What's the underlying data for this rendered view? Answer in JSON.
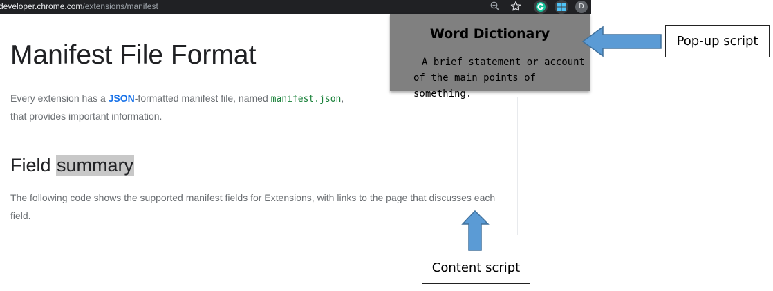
{
  "browser": {
    "url_host": "developer.chrome.com",
    "url_path": "/extensions/manifest",
    "avatar_letter": "D",
    "icons": [
      "zoom-icon",
      "star-icon",
      "grammarly-icon",
      "windows-icon"
    ]
  },
  "page": {
    "title": "Manifest File Format",
    "intro": {
      "prefix": "Every extension has a ",
      "json_link": "JSON",
      "middle": "-formatted manifest file, named ",
      "code": "manifest.json",
      "suffix_line1": ",",
      "line2": "that provides important information."
    },
    "section": {
      "title_plain": "Field ",
      "title_highlight": "summary"
    },
    "body": "The following code shows the supported manifest fields for Extensions, with links to the page that discusses each field."
  },
  "popup": {
    "title": "Word Dictionary",
    "definition": "A brief statement or account of the main points of something."
  },
  "annotations": {
    "popup_label": "Pop-up script",
    "content_label": "Content script",
    "arrow_color": "#5b9bd5",
    "arrow_border": "#41719c"
  },
  "colors": {
    "browser_bar": "#202124",
    "popup_bg": "#808080",
    "link": "#1a73e8",
    "code": "#188038",
    "highlight": "#c8c8c8"
  }
}
